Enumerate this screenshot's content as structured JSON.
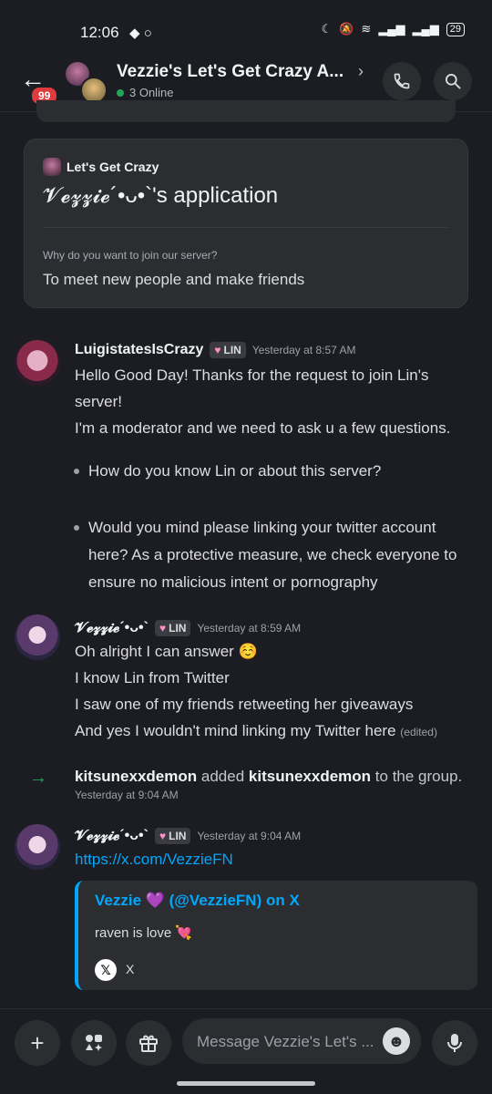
{
  "status_bar": {
    "time": "12:06",
    "battery": "29"
  },
  "header": {
    "back_badge": "99",
    "title": "Vezzie's Let's Get Crazy A...",
    "online": "3 Online"
  },
  "application_card": {
    "guild_name": "Let's Get Crazy",
    "title": "𝓥𝓮𝔃𝔃𝓲𝓮´•ᴗ•`'s application",
    "question": "Why do you want to join our server?",
    "answer": "To meet new people and make friends"
  },
  "messages": [
    {
      "author": "LuigistatesIsCrazy",
      "tag": "LIN",
      "timestamp": "Yesterday at 8:57 AM",
      "lines": [
        "Hello Good Day! Thanks for the request to join Lin's",
        "server!",
        "I'm a moderator and we need to ask u a few questions."
      ],
      "bullets": [
        "How do you know Lin or about this server?",
        "Would you mind please linking your twitter account here? As a protective measure, we check everyone to ensure no malicious intent or pornography"
      ]
    },
    {
      "author": "𝓥𝓮𝔃𝔃𝓲𝓮´•ᴗ•`",
      "tag": "LIN",
      "timestamp": "Yesterday at 8:59 AM",
      "lines": [
        "Oh alright I can answer ☺️",
        "I know Lin from Twitter",
        "I saw one of my friends retweeting her giveaways",
        "And yes I wouldn't mind linking my Twitter here"
      ],
      "edited": "(edited)"
    },
    {
      "author": "𝓥𝓮𝔃𝔃𝓲𝓮´•ᴗ•`",
      "tag": "LIN",
      "timestamp": "Yesterday at 9:04 AM",
      "link": "https://x.com/VezzieFN",
      "embed": {
        "title": "Vezzie 💜 (@VezzieFN) on X",
        "description": "raven is love 💘",
        "provider": "X"
      }
    }
  ],
  "system_message": {
    "actor": "kitsunexxdemon",
    "action": "added",
    "target": "kitsunexxdemon",
    "suffix": "to the group.",
    "timestamp": "Yesterday at 9:04 AM"
  },
  "composer": {
    "placeholder": "Message Vezzie's Let's ..."
  }
}
